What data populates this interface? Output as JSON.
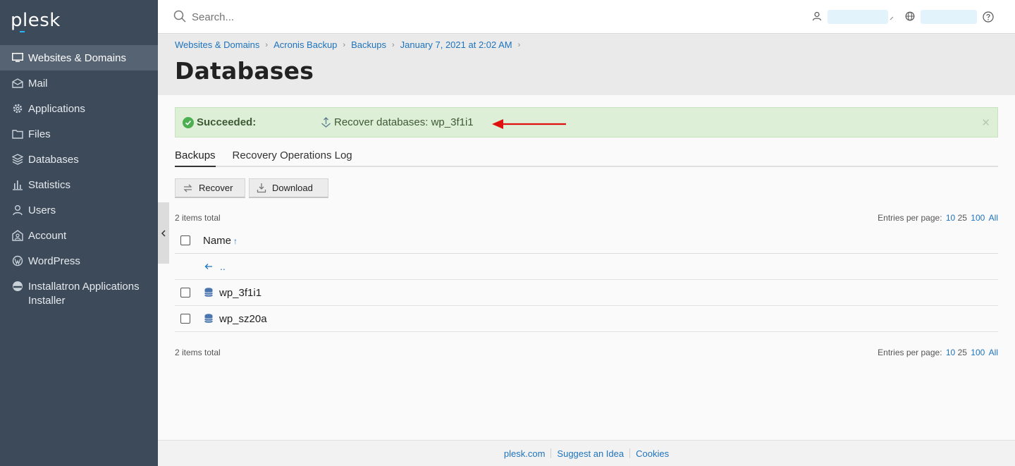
{
  "app": {
    "logo": "plesk"
  },
  "sidebar": {
    "items": [
      {
        "label": "Websites & Domains",
        "icon": "monitor-icon",
        "active": true
      },
      {
        "label": "Mail",
        "icon": "mail-icon"
      },
      {
        "label": "Applications",
        "icon": "gear-icon"
      },
      {
        "label": "Files",
        "icon": "folder-icon"
      },
      {
        "label": "Databases",
        "icon": "database-layers-icon"
      },
      {
        "label": "Statistics",
        "icon": "bar-chart-icon"
      },
      {
        "label": "Users",
        "icon": "user-icon"
      },
      {
        "label": "Account",
        "icon": "account-icon"
      },
      {
        "label": "WordPress",
        "icon": "wordpress-icon"
      },
      {
        "label": "Installatron Applications Installer",
        "icon": "installatron-icon"
      }
    ]
  },
  "topbar": {
    "search_placeholder": "Search..."
  },
  "breadcrumb": [
    "Websites & Domains",
    "Acronis Backup",
    "Backups",
    "January 7, 2021 at 2:02 AM"
  ],
  "page": {
    "title": "Databases"
  },
  "alert": {
    "status": "Succeeded:",
    "message": "Recover databases: wp_3f1i1",
    "color": "#ddefd6"
  },
  "tabs": [
    "Backups",
    "Recovery Operations Log"
  ],
  "toolbar": {
    "recover_label": "Recover",
    "download_label": "Download"
  },
  "list": {
    "total_text": "2 items total",
    "entries_label": "Entries per page:",
    "page_sizes": [
      "10",
      "25",
      "100",
      "All"
    ],
    "column_name": "Name",
    "sort_indicator": "↑",
    "up_label": "..",
    "rows": [
      "wp_3f1i1",
      "wp_sz20a"
    ]
  },
  "footer": {
    "links": [
      "plesk.com",
      "Suggest an Idea",
      "Cookies"
    ]
  }
}
